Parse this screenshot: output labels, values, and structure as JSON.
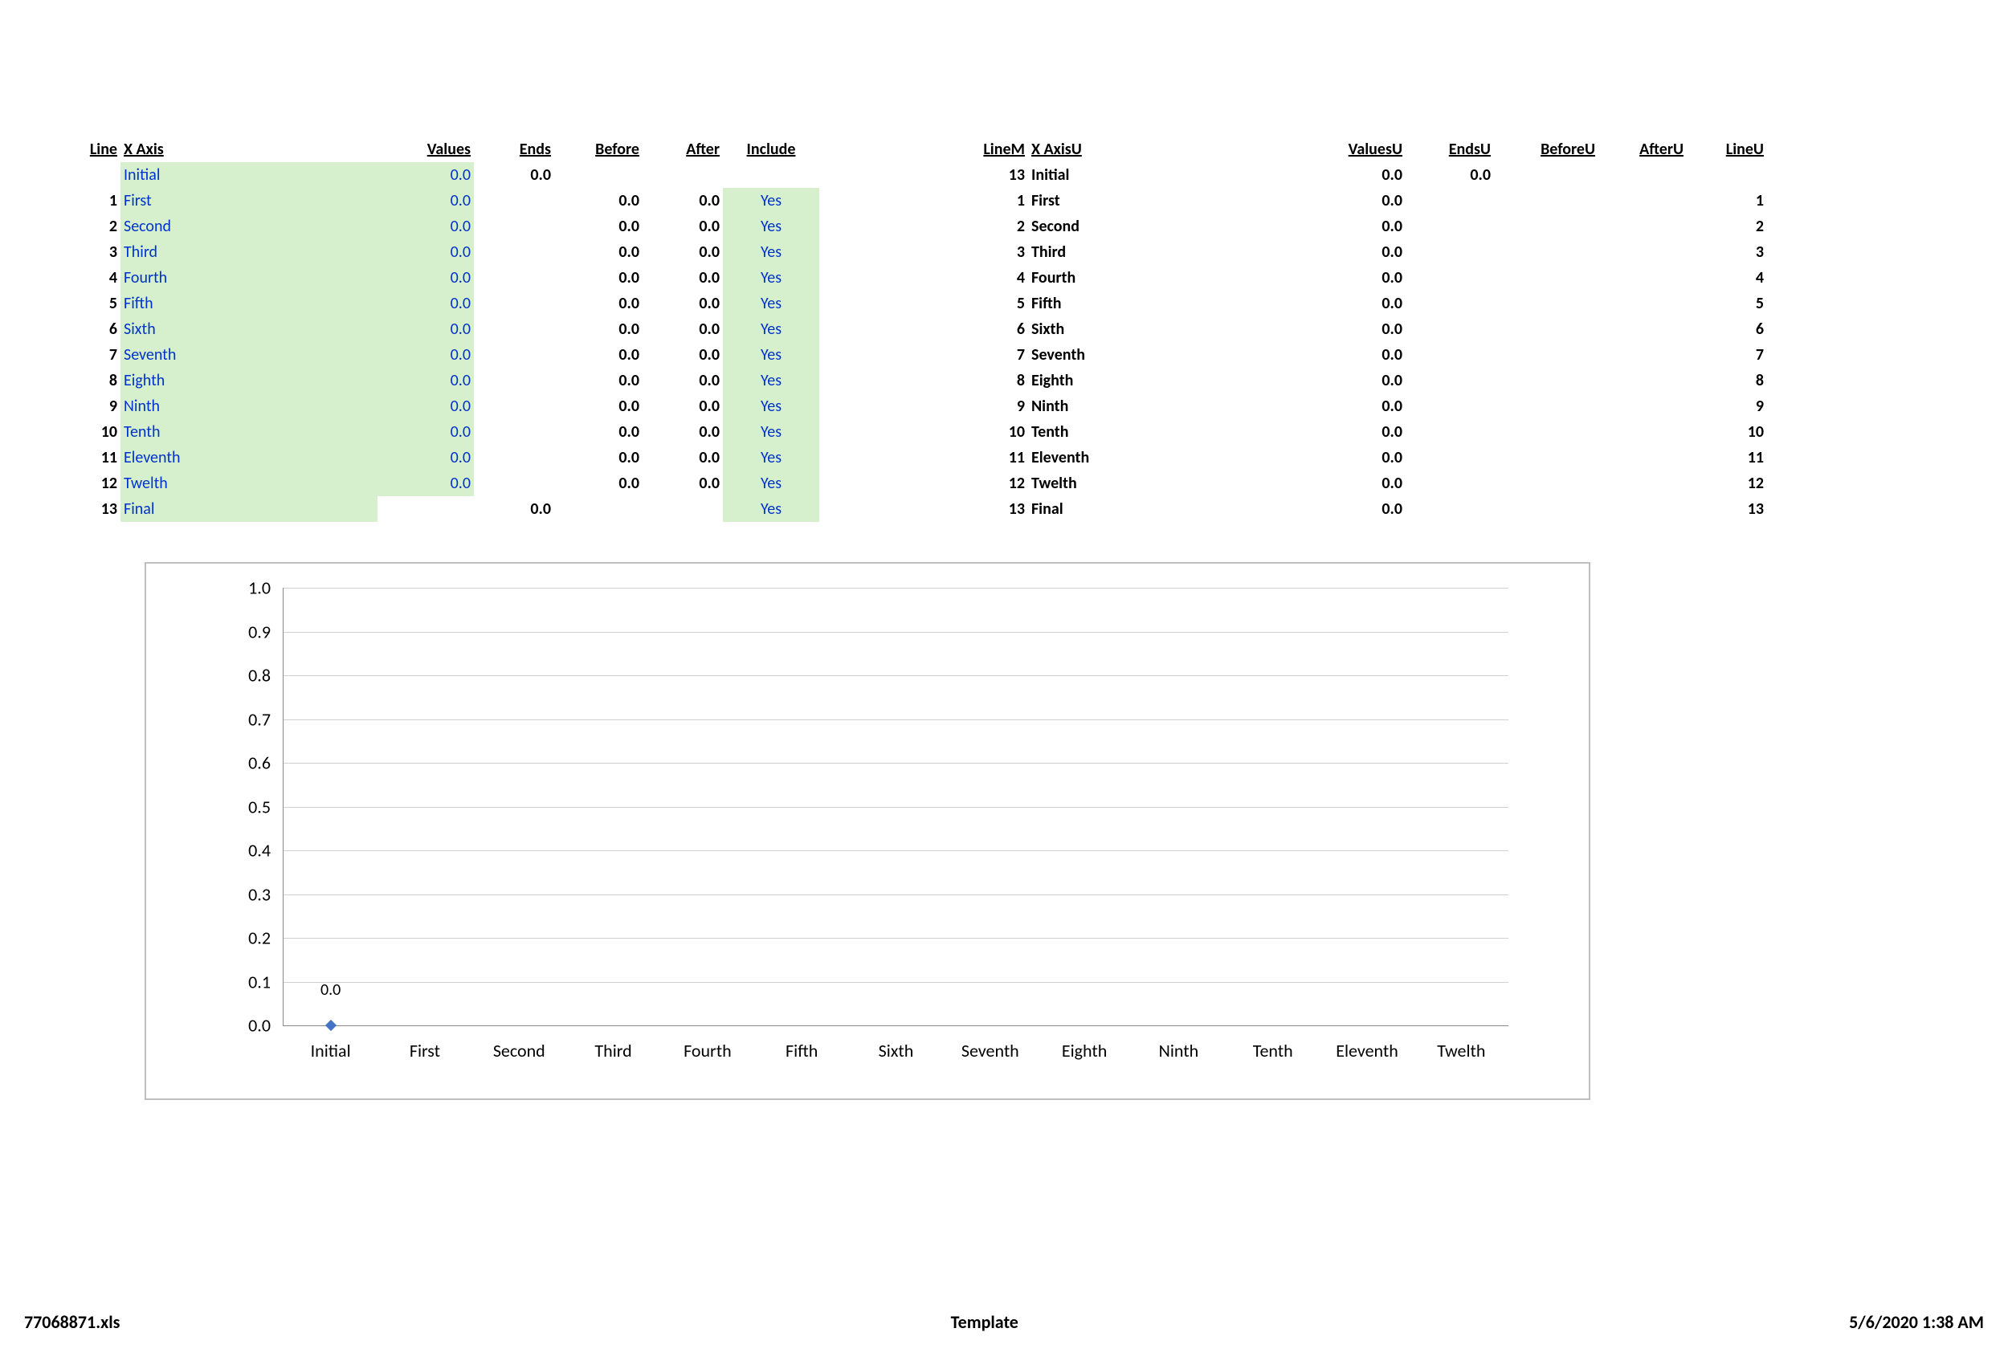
{
  "left_table": {
    "headers": [
      "Line",
      "X Axis",
      "Values",
      "Ends",
      "Before",
      "After",
      "Include"
    ],
    "rows": [
      {
        "line": "",
        "xaxis": "Initial",
        "values": "0.0",
        "ends": "0.0",
        "before": "",
        "after": "",
        "include": "",
        "green_xaxis": true,
        "green_values": true,
        "green_include": false
      },
      {
        "line": "1",
        "xaxis": "First",
        "values": "0.0",
        "ends": "",
        "before": "0.0",
        "after": "0.0",
        "include": "Yes",
        "green_xaxis": true,
        "green_values": true,
        "green_include": true
      },
      {
        "line": "2",
        "xaxis": "Second",
        "values": "0.0",
        "ends": "",
        "before": "0.0",
        "after": "0.0",
        "include": "Yes",
        "green_xaxis": true,
        "green_values": true,
        "green_include": true
      },
      {
        "line": "3",
        "xaxis": "Third",
        "values": "0.0",
        "ends": "",
        "before": "0.0",
        "after": "0.0",
        "include": "Yes",
        "green_xaxis": true,
        "green_values": true,
        "green_include": true
      },
      {
        "line": "4",
        "xaxis": "Fourth",
        "values": "0.0",
        "ends": "",
        "before": "0.0",
        "after": "0.0",
        "include": "Yes",
        "green_xaxis": true,
        "green_values": true,
        "green_include": true
      },
      {
        "line": "5",
        "xaxis": "Fifth",
        "values": "0.0",
        "ends": "",
        "before": "0.0",
        "after": "0.0",
        "include": "Yes",
        "green_xaxis": true,
        "green_values": true,
        "green_include": true
      },
      {
        "line": "6",
        "xaxis": "Sixth",
        "values": "0.0",
        "ends": "",
        "before": "0.0",
        "after": "0.0",
        "include": "Yes",
        "green_xaxis": true,
        "green_values": true,
        "green_include": true
      },
      {
        "line": "7",
        "xaxis": "Seventh",
        "values": "0.0",
        "ends": "",
        "before": "0.0",
        "after": "0.0",
        "include": "Yes",
        "green_xaxis": true,
        "green_values": true,
        "green_include": true
      },
      {
        "line": "8",
        "xaxis": "Eighth",
        "values": "0.0",
        "ends": "",
        "before": "0.0",
        "after": "0.0",
        "include": "Yes",
        "green_xaxis": true,
        "green_values": true,
        "green_include": true
      },
      {
        "line": "9",
        "xaxis": "Ninth",
        "values": "0.0",
        "ends": "",
        "before": "0.0",
        "after": "0.0",
        "include": "Yes",
        "green_xaxis": true,
        "green_values": true,
        "green_include": true
      },
      {
        "line": "10",
        "xaxis": "Tenth",
        "values": "0.0",
        "ends": "",
        "before": "0.0",
        "after": "0.0",
        "include": "Yes",
        "green_xaxis": true,
        "green_values": true,
        "green_include": true
      },
      {
        "line": "11",
        "xaxis": "Eleventh",
        "values": "0.0",
        "ends": "",
        "before": "0.0",
        "after": "0.0",
        "include": "Yes",
        "green_xaxis": true,
        "green_values": true,
        "green_include": true
      },
      {
        "line": "12",
        "xaxis": "Twelth",
        "values": "0.0",
        "ends": "",
        "before": "0.0",
        "after": "0.0",
        "include": "Yes",
        "green_xaxis": true,
        "green_values": true,
        "green_include": true
      },
      {
        "line": "13",
        "xaxis": "Final",
        "values": "",
        "ends": "0.0",
        "before": "",
        "after": "",
        "include": "Yes",
        "green_xaxis": true,
        "green_values": false,
        "green_include": true
      }
    ]
  },
  "right_table": {
    "headers": [
      "LineM",
      "X AxisU",
      "ValuesU",
      "EndsU",
      "BeforeU",
      "AfterU",
      "LineU"
    ],
    "rows": [
      {
        "linem": "13",
        "xaxisu": "Initial",
        "valuesu": "0.0",
        "endsu": "0.0",
        "beforeu": "",
        "afteru": "",
        "lineu": ""
      },
      {
        "linem": "1",
        "xaxisu": "First",
        "valuesu": "0.0",
        "endsu": "",
        "beforeu": "",
        "afteru": "",
        "lineu": "1"
      },
      {
        "linem": "2",
        "xaxisu": "Second",
        "valuesu": "0.0",
        "endsu": "",
        "beforeu": "",
        "afteru": "",
        "lineu": "2"
      },
      {
        "linem": "3",
        "xaxisu": "Third",
        "valuesu": "0.0",
        "endsu": "",
        "beforeu": "",
        "afteru": "",
        "lineu": "3"
      },
      {
        "linem": "4",
        "xaxisu": "Fourth",
        "valuesu": "0.0",
        "endsu": "",
        "beforeu": "",
        "afteru": "",
        "lineu": "4"
      },
      {
        "linem": "5",
        "xaxisu": "Fifth",
        "valuesu": "0.0",
        "endsu": "",
        "beforeu": "",
        "afteru": "",
        "lineu": "5"
      },
      {
        "linem": "6",
        "xaxisu": "Sixth",
        "valuesu": "0.0",
        "endsu": "",
        "beforeu": "",
        "afteru": "",
        "lineu": "6"
      },
      {
        "linem": "7",
        "xaxisu": "Seventh",
        "valuesu": "0.0",
        "endsu": "",
        "beforeu": "",
        "afteru": "",
        "lineu": "7"
      },
      {
        "linem": "8",
        "xaxisu": "Eighth",
        "valuesu": "0.0",
        "endsu": "",
        "beforeu": "",
        "afteru": "",
        "lineu": "8"
      },
      {
        "linem": "9",
        "xaxisu": "Ninth",
        "valuesu": "0.0",
        "endsu": "",
        "beforeu": "",
        "afteru": "",
        "lineu": "9"
      },
      {
        "linem": "10",
        "xaxisu": "Tenth",
        "valuesu": "0.0",
        "endsu": "",
        "beforeu": "",
        "afteru": "",
        "lineu": "10"
      },
      {
        "linem": "11",
        "xaxisu": "Eleventh",
        "valuesu": "0.0",
        "endsu": "",
        "beforeu": "",
        "afteru": "",
        "lineu": "11"
      },
      {
        "linem": "12",
        "xaxisu": "Twelth",
        "valuesu": "0.0",
        "endsu": "",
        "beforeu": "",
        "afteru": "",
        "lineu": "12"
      },
      {
        "linem": "13",
        "xaxisu": "Final",
        "valuesu": "0.0",
        "endsu": "",
        "beforeu": "",
        "afteru": "",
        "lineu": "13"
      }
    ]
  },
  "chart_data": {
    "type": "line",
    "categories": [
      "Initial",
      "First",
      "Second",
      "Third",
      "Fourth",
      "Fifth",
      "Sixth",
      "Seventh",
      "Eighth",
      "Ninth",
      "Tenth",
      "Eleventh",
      "Twelth"
    ],
    "values": [
      0.0,
      0.0,
      0.0,
      0.0,
      0.0,
      0.0,
      0.0,
      0.0,
      0.0,
      0.0,
      0.0,
      0.0,
      0.0
    ],
    "data_label": "0.0",
    "title": "",
    "xlabel": "",
    "ylabel": "",
    "ylim": [
      0.0,
      1.0
    ],
    "yticks": [
      "0.0",
      "0.1",
      "0.2",
      "0.3",
      "0.4",
      "0.5",
      "0.6",
      "0.7",
      "0.8",
      "0.9",
      "1.0"
    ]
  },
  "footer": {
    "file": "77068871.xls",
    "center": "Template",
    "timestamp": "5/6/2020 1:38 AM"
  }
}
